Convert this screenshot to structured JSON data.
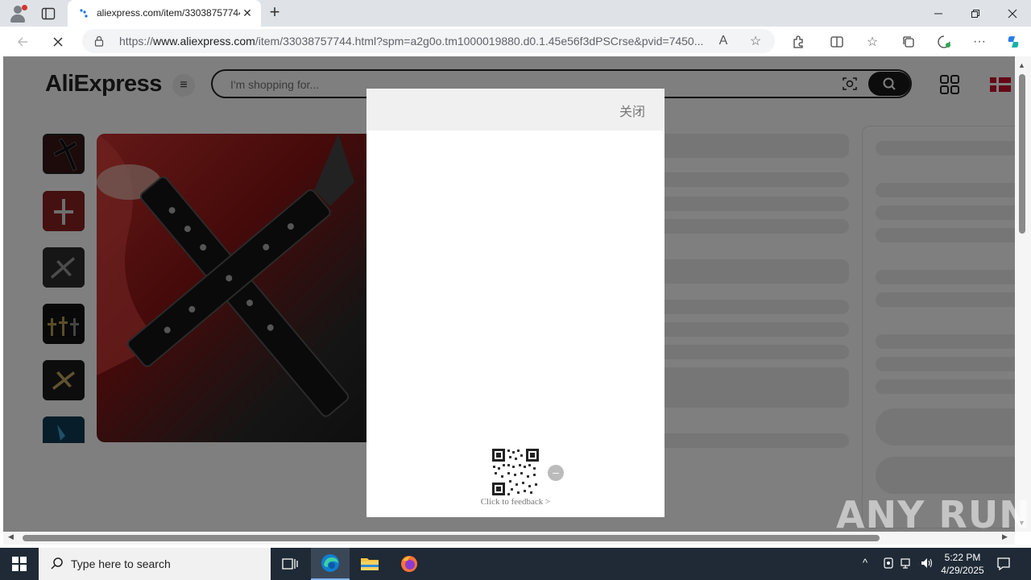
{
  "browser": {
    "tab_title": "aliexpress.com/item/33038757744",
    "url_prefix": "https://",
    "url_domain": "www.aliexpress.com",
    "url_rest": "/item/33038757744.html?spm=a2g0o.tm1000019880.d0.1.45e56f3dPSCrse&pvid=7450..."
  },
  "page": {
    "logo": "AliExpress",
    "search_placeholder": "I'm shopping for..."
  },
  "modal": {
    "close_label": "关闭",
    "feedback_link": "Click to feedback >"
  },
  "watermark": "ANY RUN",
  "taskbar": {
    "search_placeholder": "Type here to search",
    "time": "5:22 PM",
    "date": "4/29/2025"
  },
  "colors": {
    "accent_red": "#c8102e",
    "overlay": "rgba(0,0,0,0.5)"
  }
}
